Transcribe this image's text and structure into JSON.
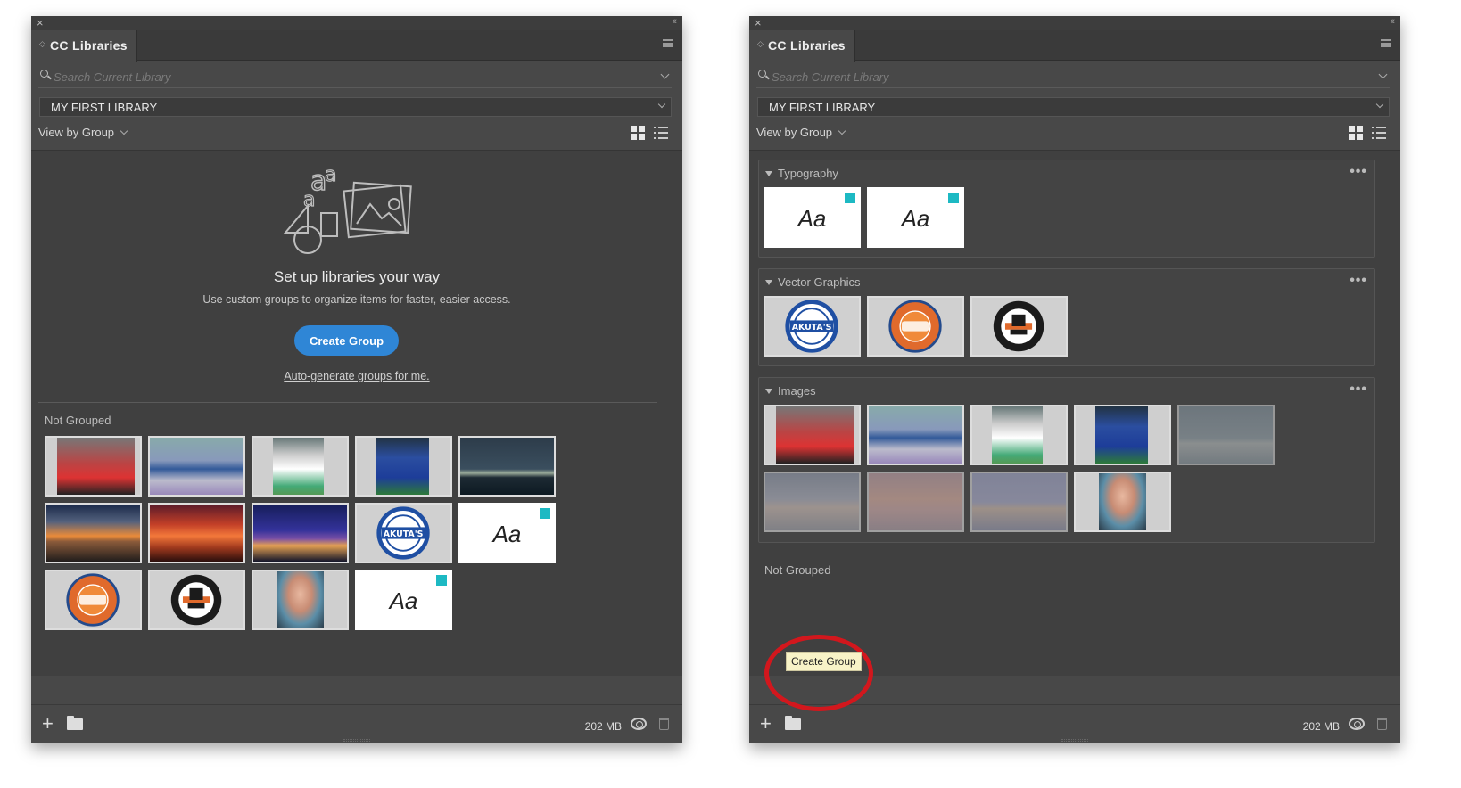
{
  "panels": [
    {
      "tab_title": "CC Libraries",
      "search_placeholder": "Search Current Library",
      "library_name": "MY FIRST LIBRARY",
      "view_by": "View by Group",
      "empty_state": {
        "title": "Set up libraries your way",
        "subtitle": "Use custom groups to organize items for faster, easier access.",
        "button": "Create Group",
        "link": "Auto-generate groups for me."
      },
      "not_grouped_label": "Not Grouped",
      "storage": "202 MB"
    },
    {
      "tab_title": "CC Libraries",
      "search_placeholder": "Search Current Library",
      "library_name": "MY FIRST LIBRARY",
      "view_by": "View by Group",
      "groups": [
        {
          "name": "Typography"
        },
        {
          "name": "Vector Graphics"
        },
        {
          "name": "Images"
        }
      ],
      "not_grouped_label": "Not Grouped",
      "tooltip": "Create Group",
      "storage": "202 MB"
    }
  ],
  "font_sample": "Aa",
  "logos": {
    "akuta": "AKUTA'S",
    "podcast": "HE SHOOTS, HE DRAWS",
    "inspired": "GET INSPIRED BY"
  },
  "colors": {
    "accent": "#2f86d6",
    "font_badge": "#1db9c3",
    "highlight": "#d2171d"
  }
}
